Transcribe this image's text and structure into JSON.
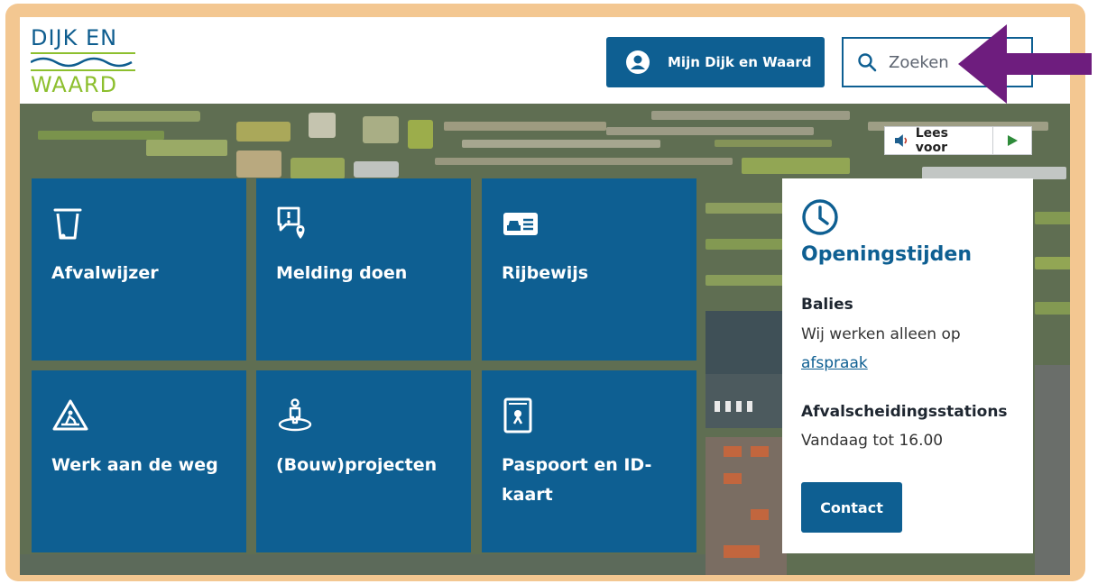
{
  "logo": {
    "line1": "DIJK EN",
    "line2": "WAARD"
  },
  "header": {
    "login_label": "Mijn Dijk en Waard",
    "search_placeholder": "Zoeken"
  },
  "readspeaker": {
    "label": "Lees voor"
  },
  "tiles": [
    {
      "label": "Afvalwijzer",
      "icon": "waste-bin-icon"
    },
    {
      "label": "Melding doen",
      "icon": "report-location-icon"
    },
    {
      "label": "Rijbewijs",
      "icon": "drivers-license-icon"
    },
    {
      "label": "Werk aan de weg",
      "icon": "roadwork-sign-icon"
    },
    {
      "label": "(Bouw)projecten",
      "icon": "project-pin-icon"
    },
    {
      "label": "Paspoort en ID-kaart",
      "icon": "passport-icon"
    }
  ],
  "hours": {
    "title": "Openingstijden",
    "section1_title": "Balies",
    "section1_text": "Wij werken alleen op",
    "section1_link": "afspraak",
    "section2_title": "Afvalscheidingsstations",
    "section2_text": "Vandaag tot 16.00",
    "contact_label": "Contact"
  },
  "colors": {
    "brand_blue": "#0e5f92",
    "logo_green": "#8dbf2e",
    "frame": "#f3c791",
    "arrow": "#6e1d7e"
  }
}
